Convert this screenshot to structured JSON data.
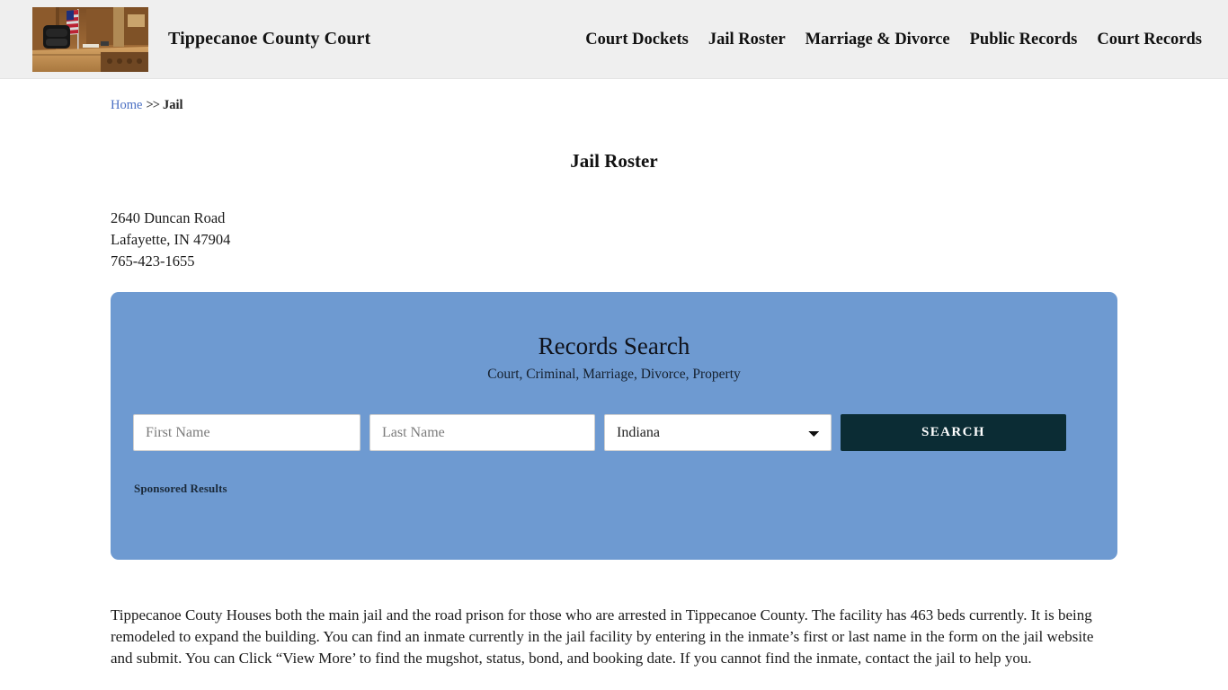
{
  "header": {
    "logo_icon": "courtroom-photo",
    "brand_title": "Tippecanoe County Court",
    "nav_items": [
      {
        "label": "Court Dockets"
      },
      {
        "label": "Jail Roster"
      },
      {
        "label": "Marriage & Divorce"
      },
      {
        "label": "Public Records"
      },
      {
        "label": "Court Records"
      }
    ]
  },
  "breadcrumb": {
    "home_label": "Home",
    "separator": ">>",
    "current_label": "Jail"
  },
  "page": {
    "title": "Jail Roster"
  },
  "facility": {
    "street": "2640 Duncan Road",
    "city_state_zip": "Lafayette, IN 47904",
    "phone": "765-423-1655"
  },
  "search_panel": {
    "title": "Records Search",
    "subtitle": "Court, Criminal, Marriage, Divorce, Property",
    "first_name_placeholder": "First Name",
    "first_name_value": "",
    "last_name_placeholder": "Last Name",
    "last_name_value": "",
    "state_selected": "Indiana",
    "state_options": [
      "Indiana"
    ],
    "search_button_label": "SEARCH",
    "sponsored_label": "Sponsored Results",
    "panel_color": "#6e9ad1",
    "button_color": "#0b2c34"
  },
  "content": {
    "paragraph": "Tippecanoe Couty Houses both the main jail and the road prison for those who are arrested in Tippecanoe County. The facility has 463 beds currently. It is being remodeled to expand the building. You can find an inmate currently in the jail facility by entering in the inmate’s first or last name in the form on the jail website and submit. You can Click “View More’ to find the mugshot, status, bond, and booking date. If you cannot find the inmate, contact the jail to help you."
  }
}
